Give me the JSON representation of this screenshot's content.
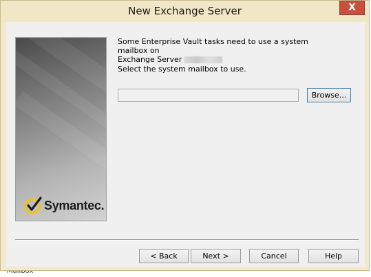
{
  "window": {
    "title": "New Exchange Server",
    "close_label": "X"
  },
  "side_panel": {
    "logo_text": "Symantec.",
    "logo_icon": "symantec-checkmark-logo",
    "brand_color": "#f5c400"
  },
  "content": {
    "intro_line1": "Some Enterprise Vault tasks need to use a system mailbox on",
    "intro_line2": "Exchange Server",
    "prompt": "Select the system mailbox to use.",
    "mailbox_value": "",
    "browse_label": "Browse..."
  },
  "footer": {
    "back_label": "< Back",
    "next_label": "Next >",
    "cancel_label": "Cancel",
    "help_label": "Help"
  },
  "background": {
    "partial_text": "Mailbox"
  }
}
